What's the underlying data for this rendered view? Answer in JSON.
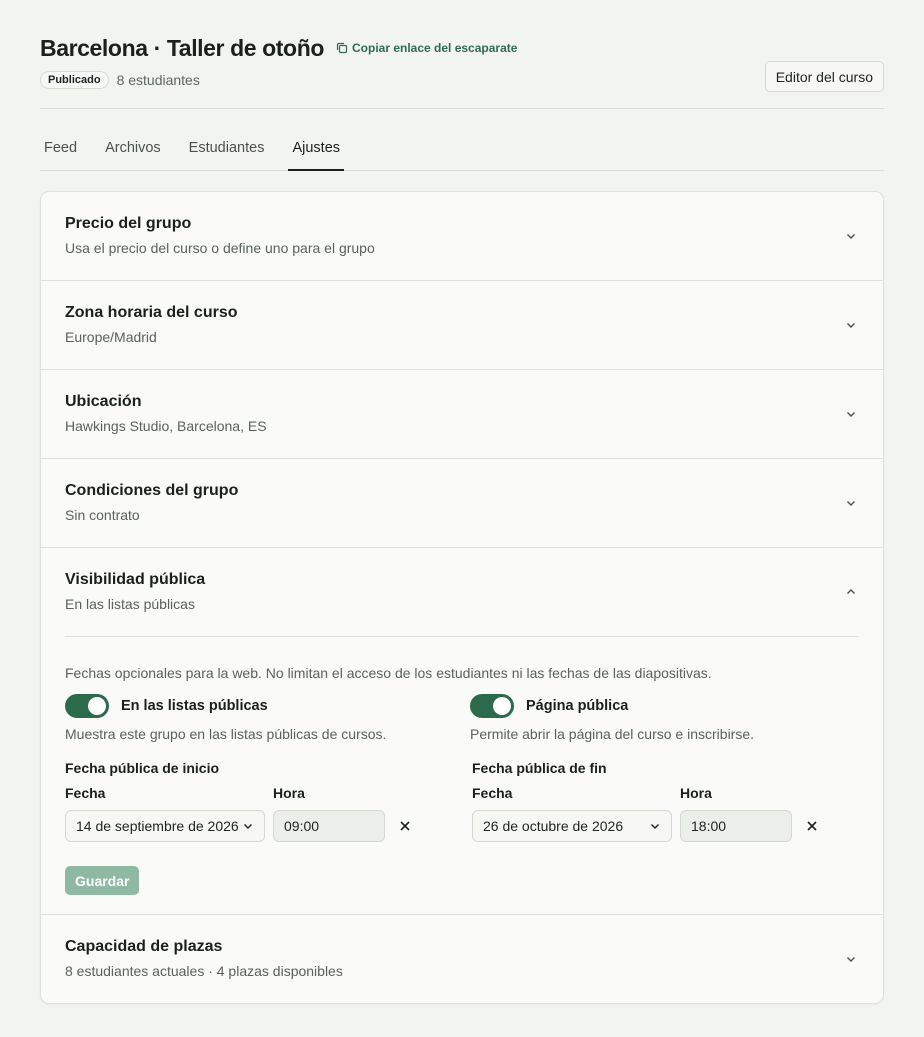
{
  "header": {
    "title": "Barcelona · Taller de otoño",
    "copy_link_label": "Copiar enlace del escaparate",
    "status_badge": "Publicado",
    "student_count": "8 estudiantes",
    "editor_button": "Editor del curso"
  },
  "tabs": [
    {
      "label": "Feed"
    },
    {
      "label": "Archivos"
    },
    {
      "label": "Estudiantes"
    },
    {
      "label": "Ajustes",
      "active": true
    }
  ],
  "sections": {
    "price": {
      "title": "Precio del grupo",
      "subtitle": "Usa el precio del curso o define uno para el grupo"
    },
    "timezone": {
      "title": "Zona horaria del curso",
      "subtitle": "Europe/Madrid"
    },
    "location": {
      "title": "Ubicación",
      "subtitle": "Hawkings Studio, Barcelona, ES"
    },
    "conditions": {
      "title": "Condiciones del grupo",
      "subtitle": "Sin contrato"
    },
    "visibility": {
      "title": "Visibilidad pública",
      "subtitle": "En las listas públicas",
      "hint": "Fechas opcionales para la web. No limitan el acceso de los estudiantes ni las fechas de las diapositivas.",
      "listing_toggle": {
        "label": "En las listas públicas",
        "description": "Muestra este grupo en las listas públicas de cursos.",
        "on": true
      },
      "page_toggle": {
        "label": "Página pública",
        "description": "Permite abrir la página del curso e inscribirse.",
        "on": true
      },
      "start": {
        "group_label": "Fecha pública de inicio",
        "date_label": "Fecha",
        "time_label": "Hora",
        "date_value": "14 de septiembre de 2026",
        "time_value": "09:00"
      },
      "end": {
        "group_label": "Fecha pública de fin",
        "date_label": "Fecha",
        "time_label": "Hora",
        "date_value": "26 de octubre de 2026",
        "time_value": "18:00"
      },
      "save_label": "Guardar"
    },
    "capacity": {
      "title": "Capacidad de plazas",
      "subtitle": "8 estudiantes actuales · 4 plazas disponibles"
    }
  },
  "colors": {
    "accent": "#2c6a4c",
    "accent_disabled": "#8fb9a2",
    "background": "#f2f4f0"
  }
}
